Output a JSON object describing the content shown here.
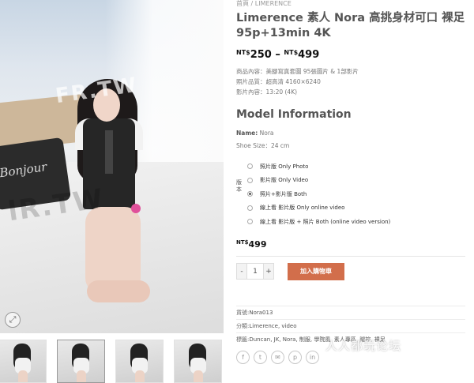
{
  "breadcrumb": {
    "home": "首頁",
    "sep": "/",
    "current": "LIMERENCE"
  },
  "product": {
    "title": "Limerence 素人 Nora 高挑身材可口 裸足 95p+13min 4K",
    "price_currency": "NT$",
    "price_low": "250",
    "price_dash": "–",
    "price_high": "499",
    "meta": [
      "商品內容：美腳寫真套圖 95張圖片 & 1部影片",
      "照片品質：超高清 4160×6240",
      "影片內容：13:20 (4K)"
    ]
  },
  "model": {
    "heading": "Model Information",
    "name_label": "Name:",
    "name_value": "Nora",
    "shoe_label": "Shoe Size：",
    "shoe_value": "24 cm"
  },
  "version": {
    "label": "版本",
    "options": [
      "照片版 Only Photo",
      "影片版 Only Video",
      "照片+影片版 Both",
      "線上看 影片版 Only online video",
      "線上看 影片版 + 照片 Both (online video version)"
    ],
    "selected_index": 2
  },
  "variant_price": {
    "currency": "NT$",
    "value": "499"
  },
  "cart": {
    "minus": "-",
    "qty": "1",
    "plus": "+",
    "add_label": "加入購物車"
  },
  "product_meta": {
    "sku_label": "貨號:",
    "sku": "Nora013",
    "cat_label": "分類:",
    "categories": "Limerence, video",
    "tag_label": "標籤:",
    "tags": "Duncan, JK, Nora, 制服, 學院風, 素人專區, 腿控, 裸足"
  },
  "share_icons": [
    "facebook-icon",
    "twitter-icon",
    "email-icon",
    "pinterest-icon",
    "linkedin-icon"
  ],
  "gallery": {
    "watermark_main": "lR.TW",
    "watermark_top": "FR.TW",
    "pillow_text": "Bonjour",
    "zoom_glyph": "⤢"
  },
  "forum_watermark": "人人都玩论坛",
  "colors": {
    "add_to_cart": "#d26e4b",
    "title": "#555555",
    "price": "#111111"
  }
}
